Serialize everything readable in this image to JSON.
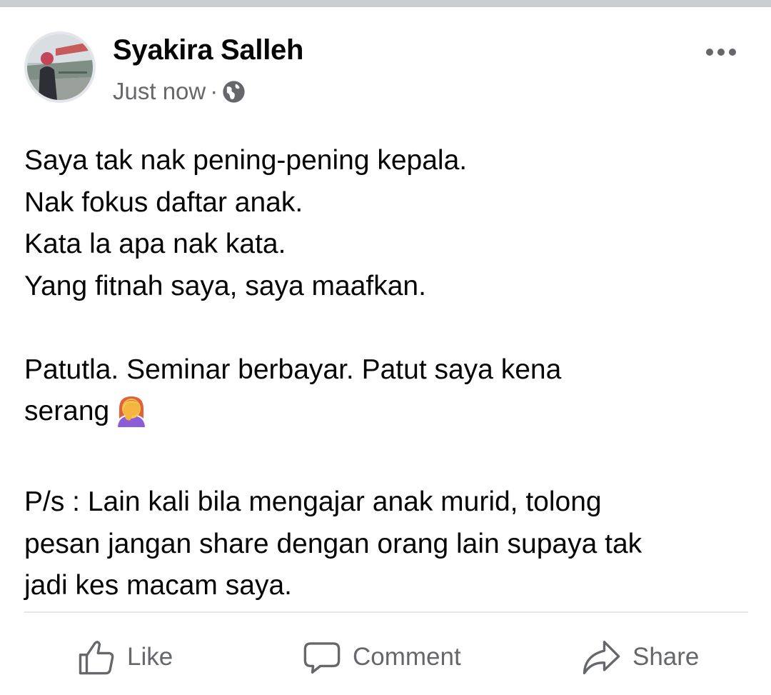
{
  "post": {
    "author": "Syakira Salleh",
    "timestamp": "Just now",
    "separator": "·",
    "privacy_icon": "globe-icon",
    "more_icon": "more-options-icon",
    "lines": [
      "Saya tak nak pening-pening kepala.",
      "Nak fokus daftar anak.",
      "Kata la apa nak kata.",
      "Yang fitnah saya, saya maafkan.",
      "Patutla. Seminar berbayar. Patut saya kena",
      "serang",
      "P/s : Lain kali bila mengajar anak murid, tolong",
      "pesan jangan share dengan orang lain supaya tak",
      "jadi kes macam saya."
    ],
    "emoji": "woman-facepalming-icon"
  },
  "actions": {
    "like_label": "Like",
    "comment_label": "Comment",
    "share_label": "Share"
  },
  "colors": {
    "text": "#050505",
    "secondary_text": "#65676b",
    "divider": "#e4e6eb",
    "top_bar": "#c9ccd1"
  }
}
